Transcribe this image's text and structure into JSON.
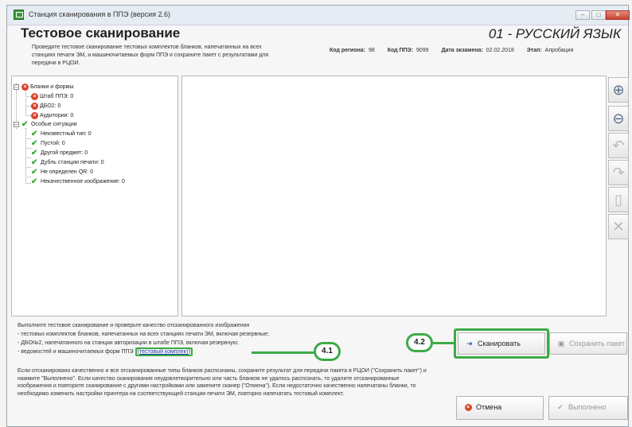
{
  "window": {
    "title": "Станция сканирования в ППЭ (версия 2.6)"
  },
  "header": {
    "title": "Тестовое сканирование",
    "description": "Проведите тестовое сканирование тестовых комплектов бланков, напечатанных на всех станциях печати ЭМ, и машиночитаемых форм ППЭ и сохраните пакет с результатами для передачи в РЦОИ.",
    "subject": "01 - РУССКИЙ ЯЗЫК",
    "meta": [
      {
        "label": "Код региона:",
        "value": "98"
      },
      {
        "label": "Код ППЭ:",
        "value": "9099"
      },
      {
        "label": "Дата экзамена:",
        "value": "02.02.2018"
      },
      {
        "label": "Этап:",
        "value": "Апробация"
      }
    ]
  },
  "tree": {
    "group1": {
      "label": "Бланки и формы",
      "items": [
        "Штаб ППЭ: 0",
        "ДБО2: 0",
        "Аудитории: 0"
      ]
    },
    "group2": {
      "label": "Особые ситуации",
      "items": [
        "Неизвестный тип: 0",
        "Пустой: 0",
        "Другой предмет: 0",
        "Дубль станции печати: 0",
        "Не определен QR: 0",
        "Некачественное изображение: 0"
      ]
    }
  },
  "sidebar": {
    "icons": [
      "zoom-in-icon",
      "zoom-out-icon",
      "rotate-left-icon",
      "rotate-right-icon",
      "page-icon",
      "delete-icon"
    ]
  },
  "instructions": {
    "line1": "Выполните тестовое сканирование и проверьте качество отсканированного изображения",
    "line2": "- тестовых комплектов бланков, напечатанных на всех станциях печати ЭМ, включая резервные;",
    "line3": "- ДБО№2, напечатанного на станции авторизации в штабе ППЭ, включая резервную;",
    "line4_prefix": "- ведомостей и машиночитаемых форм ППЭ",
    "line4_link": "тестовый комплект",
    "note": "Если отсканировано качественно и все отсканированные типы бланков распознаны, сохраните результат для передачи пакета в РЦОИ (\"Сохранить пакет\") и нажмите \"Выполнено\". Если качество сканирования неудовлетворительно или часть бланков не удалось распознать, то удалите отсканированные изображения и повторите сканирование с другими настройками или замените сканер (\"Отмена\"). Если недостаточно качественно напечатаны бланки, то необходимо изменить настройки принтера на соответствующей станции печати ЭМ, повторно напечатать тестовый комплект."
  },
  "buttons": {
    "scan": "Сканировать",
    "save_package": "Сохранить пакет",
    "cancel": "Отмена",
    "done": "Выполнено"
  },
  "annotations": {
    "badge1": "4.1",
    "badge2": "4.2"
  },
  "colors": {
    "highlight": "#3daa48",
    "error": "#d9442b",
    "ok": "#39a83c"
  }
}
